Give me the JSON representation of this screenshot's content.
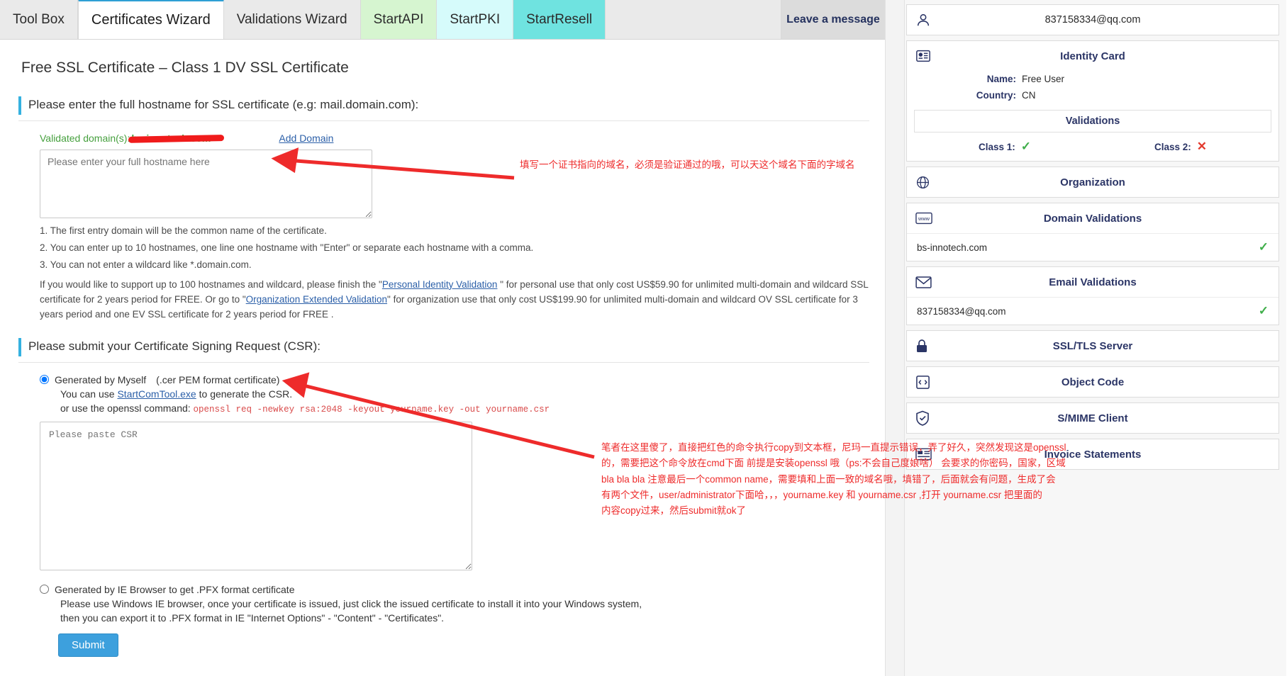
{
  "tabs": [
    {
      "label": "Tool Box",
      "style": "plain",
      "active": false
    },
    {
      "label": "Certificates Wizard",
      "style": "plain",
      "active": true
    },
    {
      "label": "Validations Wizard",
      "style": "plain",
      "active": false
    },
    {
      "label": "StartAPI",
      "style": "api",
      "active": false
    },
    {
      "label": "StartPKI",
      "style": "pki",
      "active": false
    },
    {
      "label": "StartResell",
      "style": "resell",
      "active": false
    }
  ],
  "leave_message": "Leave a message",
  "page": {
    "title": "Free SSL Certificate – Class 1 DV SSL Certificate",
    "hostname_section": {
      "heading": "Please enter the full hostname for SSL certificate (e.g: mail.domain.com):",
      "validated_label": "Validated domain(s):",
      "validated_domain": "bs-innotech.com",
      "add_domain_link": "Add Domain",
      "textarea_placeholder": "Please enter your full hostname here",
      "textarea_value": "",
      "notes": [
        "1. The first entry domain will be the common name of the certificate.",
        "2. You can enter up to 10 hostnames, one line one hostname with \"Enter\" or separate each hostname with a comma.",
        "3. You can not enter a wildcard like *.domain.com."
      ],
      "paragraph": {
        "p1a": "If you would like to support up to 100 hostnames and wildcard, please finish the \"",
        "link1": "Personal Identity Validation",
        "p1b": " \" for personal use that only cost US$59.90 for unlimited multi-domain and wildcard SSL certificate for 2 years period for FREE. Or go to \"",
        "link2": "Organization Extended Validation",
        "p1c": "\" for organization use that only cost US$199.90 for unlimited multi-domain and wildcard OV SSL certificate for 3 years period and one EV SSL certificate for 2 years period for FREE ."
      }
    },
    "csr_section": {
      "heading": "Please submit your Certificate Signing Request (CSR):",
      "option1": {
        "label": "Generated by Myself",
        "suffix": "(.cer PEM format certificate)",
        "selected": true,
        "line_prefix": "You can use ",
        "tool_link": "StartComTool.exe",
        "line_suffix": " to generate the CSR.",
        "openssl_prefix": "or use the openssl command: ",
        "openssl_command": "openssl req -newkey rsa:2048 -keyout yourname.key -out yourname.csr"
      },
      "csr_placeholder": "Please paste CSR",
      "csr_value": "",
      "option2": {
        "label": "Generated by IE Browser to get .PFX format certificate",
        "selected": false,
        "line1": "Please use Windows IE browser, once your certificate is issued, just click the issued certificate to install it into your Windows system,",
        "line2": "then you can export it to .PFX format in IE \"Internet Options\" - \"Content\" - \"Certificates\"."
      },
      "submit_label": "Submit"
    }
  },
  "annotations": [
    {
      "id": "hostname-note",
      "text": "填写一个证书指向的域名，必须是验证通过的哦，可以天这个域名下面的字域名"
    },
    {
      "id": "csr-note",
      "lines": [
        "笔者在这里傻了，直接把红色的命令执行copy到文本框，尼玛一直提示错误，弄了好久，突然发现这是openssl",
        "的，需要把这个命令放在cmd下面 前提是安装openssl 哦（ps:不会自己度娘啥） 会要求的你密码，国家，区域",
        "bla bla bla 注意最后一个common name，需要填和上面一致的域名哦，填错了，后面就会有问题，生成了会",
        "有两个文件，user/administrator下面哈，，，yourname.key 和 yourname.csr ,打开 yourname.csr 把里面的",
        "内容copy过来，然后submit就ok了"
      ]
    }
  ],
  "sidebar": {
    "account": {
      "icon": "user-icon",
      "email": "837158334@qq.com"
    },
    "identity_card": {
      "icon": "id-card-icon",
      "title": "Identity Card",
      "fields": [
        {
          "key": "Name:",
          "value": "Free  User"
        },
        {
          "key": "Country:",
          "value": "CN"
        }
      ],
      "validations_title": "Validations",
      "classes": [
        {
          "label": "Class 1:",
          "status": "ok",
          "glyph": "✓"
        },
        {
          "label": "Class 2:",
          "status": "bad",
          "glyph": "✕"
        }
      ]
    },
    "panels": [
      {
        "icon": "globe-icon",
        "title": "Organization",
        "rows": []
      },
      {
        "icon": "www-icon",
        "title": "Domain Validations",
        "rows": [
          {
            "text": "bs-innotech.com",
            "status": "ok",
            "glyph": "✓"
          }
        ]
      },
      {
        "icon": "envelope-icon",
        "title": "Email Validations",
        "rows": [
          {
            "text": "837158334@qq.com",
            "status": "ok",
            "glyph": "✓"
          }
        ]
      },
      {
        "icon": "lock-icon",
        "title": "SSL/TLS Server",
        "rows": []
      },
      {
        "icon": "code-lock-icon",
        "title": "Object Code",
        "rows": []
      },
      {
        "icon": "shield-icon",
        "title": "S/MIME Client",
        "rows": []
      },
      {
        "icon": "invoice-icon",
        "title": "Invoice Statements",
        "rows": []
      }
    ]
  },
  "colors": {
    "accent_blue": "#35b1e0",
    "annotation_red": "#ee2b2b",
    "validated_green": "#46a03e",
    "navy": "#2b3566"
  }
}
